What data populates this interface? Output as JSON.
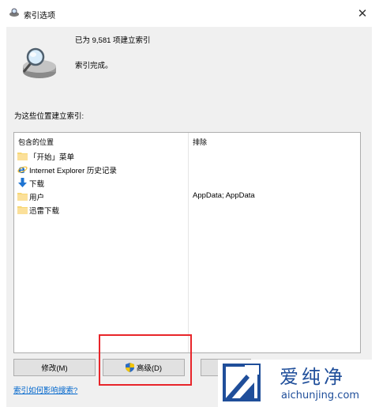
{
  "window": {
    "title": "索引选项",
    "close_glyph": "✕"
  },
  "status": {
    "indexed_count": "已为 9,581 项建立索引",
    "index_state": "索引完成。"
  },
  "locations_label": "为这些位置建立索引:",
  "table": {
    "headers": {
      "included": "包含的位置",
      "excluded": "排除"
    },
    "rows": [
      {
        "icon": "folder-icon",
        "name": "「开始」菜单",
        "excluded": ""
      },
      {
        "icon": "internet-explorer-icon",
        "name": "Internet Explorer 历史记录",
        "excluded": ""
      },
      {
        "icon": "download-arrow-icon",
        "name": "下载",
        "excluded": ""
      },
      {
        "icon": "folder-icon",
        "name": "用户",
        "excluded": "AppData; AppData"
      },
      {
        "icon": "folder-icon",
        "name": "迅雷下载",
        "excluded": ""
      }
    ]
  },
  "buttons": {
    "modify": "修改(M)",
    "advanced": "高级(D)"
  },
  "help_link": "索引如何影响搜索?",
  "watermark": {
    "title": "爱纯净",
    "url": "aichunjing.com"
  },
  "colors": {
    "highlight": "#e8252a",
    "link": "#0066cc",
    "watermark": "#1f4e9a"
  }
}
